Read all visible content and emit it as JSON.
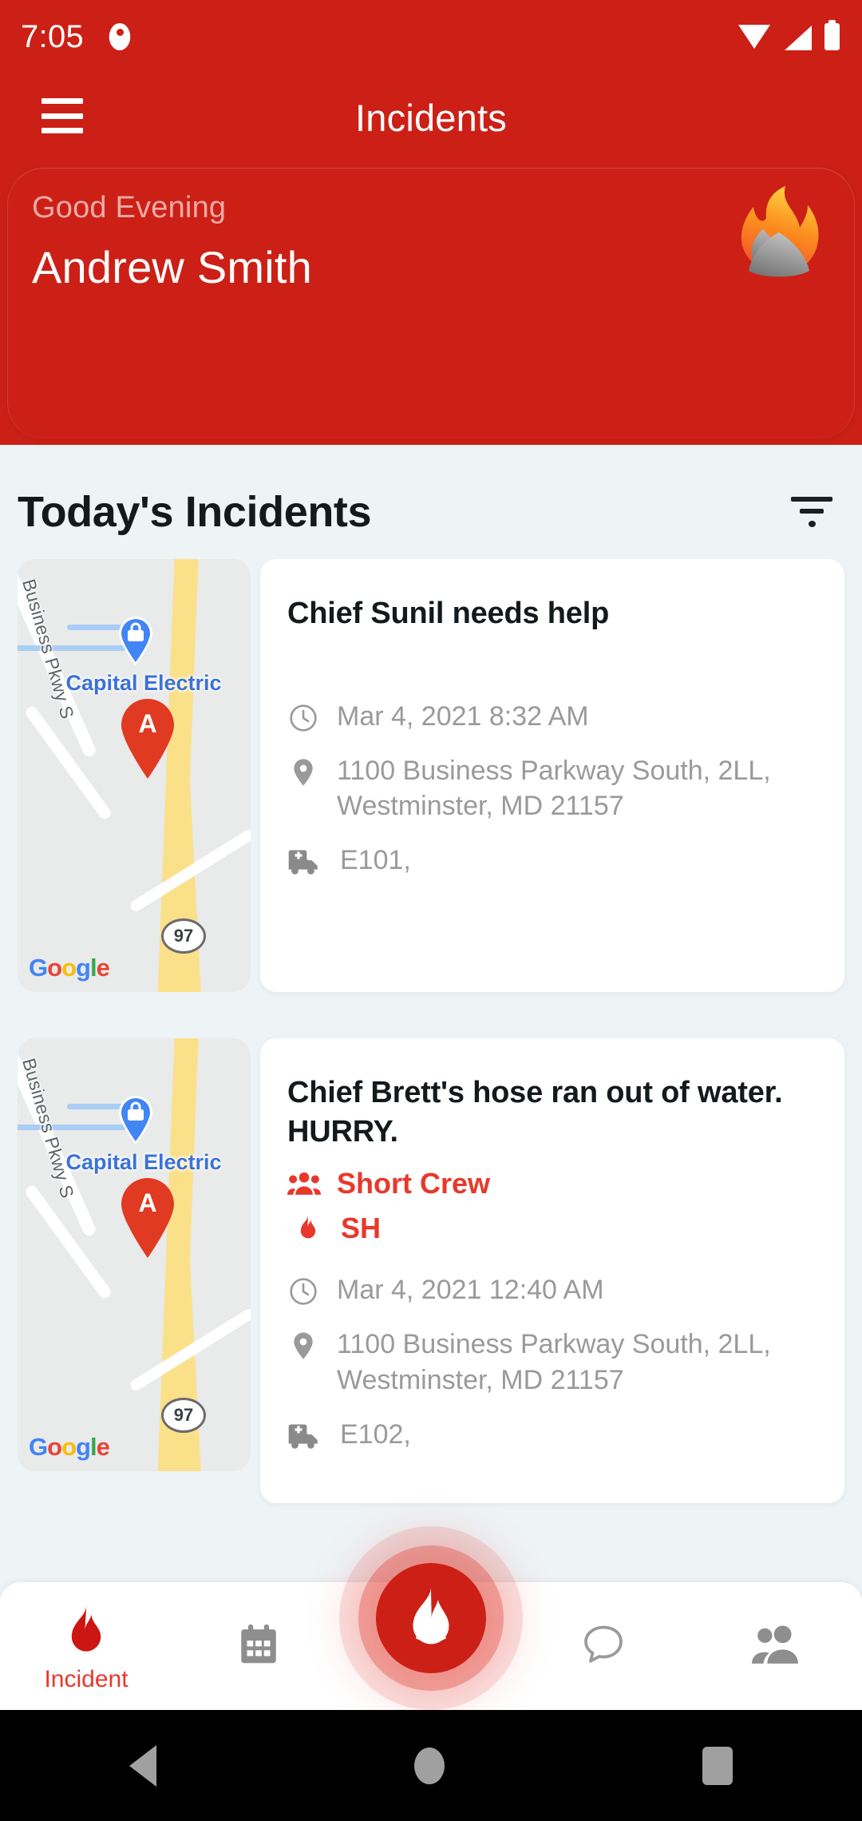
{
  "colors": {
    "brand_red": "#CC2016",
    "accent_red": "#E8382B",
    "page_bg": "#eef3f6",
    "muted_text": "#9a9a9a"
  },
  "status_bar": {
    "time": "7:05",
    "app_icon": "app-notification-icon",
    "wifi_icon": "wifi-icon",
    "signal_icon": "cellular-signal-icon",
    "battery_icon": "battery-icon"
  },
  "header": {
    "menu_icon": "hamburger-menu-icon",
    "title": "Incidents"
  },
  "greeting": {
    "salutation": "Good Evening",
    "user_name": "Andrew Smith",
    "logo_icon": "fire-flame-logo"
  },
  "section": {
    "title": "Today's Incidents",
    "filter_icon": "filter-icon"
  },
  "map_common": {
    "street_label": "Business Pkwy S",
    "business_label": "Capital Electric",
    "marker_letter": "A",
    "highway_shield": "97",
    "attribution": "Google",
    "business_pin_icon": "business-bag-pin-icon",
    "incident_pin_icon": "incident-location-pin-icon"
  },
  "incidents": [
    {
      "title": "Chief Sunil needs help",
      "tags": [],
      "time": "Mar 4, 2021 8:32 AM",
      "time_icon": "clock-icon",
      "address": "1100 Business Parkway South, 2LL, Westminster, MD 21157",
      "address_icon": "location-pin-icon",
      "units": "E101,",
      "units_icon": "fire-truck-icon"
    },
    {
      "title": "Chief Brett's hose ran out of water. HURRY.",
      "tags": [
        {
          "label": "Short Crew",
          "icon": "crew-people-icon"
        },
        {
          "label": "SH",
          "icon": "flame-icon"
        }
      ],
      "time": "Mar 4, 2021 12:40 AM",
      "time_icon": "clock-icon",
      "address": "1100 Business Parkway South, 2LL, Westminster, MD 21157",
      "address_icon": "location-pin-icon",
      "units": "E102,",
      "units_icon": "fire-truck-icon"
    }
  ],
  "bottom_nav": {
    "items": [
      {
        "label": "Incident",
        "icon": "flame-icon",
        "active": true
      },
      {
        "label": "",
        "icon": "calendar-icon",
        "active": false
      },
      {
        "label": "",
        "icon": "chat-bubble-icon",
        "active": false
      },
      {
        "label": "",
        "icon": "people-group-icon",
        "active": false
      }
    ],
    "fab_icon": "fire-flame-fab-icon"
  },
  "android_nav": {
    "back_icon": "back-triangle-icon",
    "home_icon": "home-circle-icon",
    "recents_icon": "recents-square-icon"
  }
}
